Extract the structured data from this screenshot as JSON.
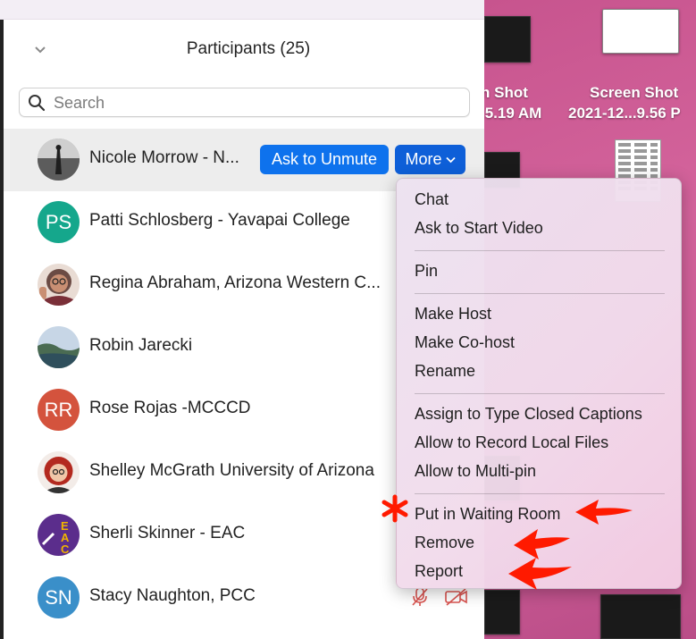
{
  "panel": {
    "title": "Participants (25)",
    "search_placeholder": "Search"
  },
  "participants": [
    {
      "name": "Nicole Morrow - N...",
      "initials": "",
      "avatar_color": "#666666"
    },
    {
      "name": "Patti Schlosberg - Yavapai College",
      "initials": "PS",
      "avatar_color": "#15a78c"
    },
    {
      "name": "Regina Abraham, Arizona Western C...",
      "initials": "",
      "avatar_color": "#c79a8f"
    },
    {
      "name": "Robin Jarecki",
      "initials": "",
      "avatar_color": "#7a8fa6"
    },
    {
      "name": "Rose Rojas -MCCCD",
      "initials": "RR",
      "avatar_color": "#d4533d"
    },
    {
      "name": "Shelley McGrath University of Arizona",
      "initials": "",
      "avatar_color": "#d9b9a8"
    },
    {
      "name": "Sherli Skinner - EAC",
      "initials": "",
      "avatar_color": "#5b2d8c"
    },
    {
      "name": "Stacy Naughton, PCC",
      "initials": "SN",
      "avatar_color": "#3a8fc9"
    }
  ],
  "actions": {
    "ask_unmute": "Ask to Unmute",
    "more": "More"
  },
  "menu": {
    "items": [
      "Chat",
      "Ask to Start Video",
      "Pin",
      "Make Host",
      "Make Co-host",
      "Rename",
      "Assign to Type Closed Captions",
      "Allow to Record Local Files",
      "Allow to Multi-pin",
      "Put in Waiting Room",
      "Remove",
      "Report"
    ]
  },
  "desktop": {
    "labels": [
      "n Shot",
      ".5.19 AM",
      "Screen Shot",
      "2021-12...9.56 P"
    ]
  },
  "colors": {
    "accent_blue": "#0e72ed",
    "annotation_red": "#ff1a00"
  }
}
